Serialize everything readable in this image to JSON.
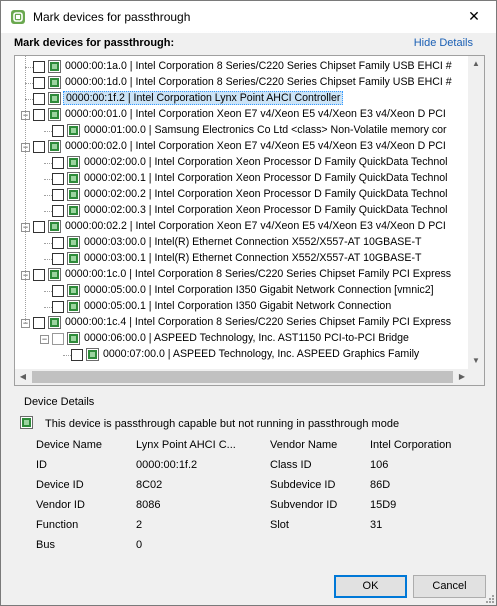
{
  "window": {
    "title": "Mark devices for passthrough",
    "close_glyph": "✕"
  },
  "section_title": "Mark devices for passthrough:",
  "hide_details": "Hide Details",
  "tree": [
    {
      "label": "0000:00:1a.0 | Intel Corporation 8 Series/C220 Series Chipset Family USB EHCI #",
      "level": 1,
      "expander": "",
      "checked": false,
      "selected": false,
      "icon": "pci-device-icon"
    },
    {
      "label": "0000:00:1d.0 | Intel Corporation 8 Series/C220 Series Chipset Family USB EHCI #",
      "level": 1,
      "expander": "",
      "checked": false,
      "selected": false,
      "icon": "pci-device-icon"
    },
    {
      "label": "0000:00:1f.2 | Intel Corporation Lynx Point AHCI Controller",
      "level": 1,
      "expander": "",
      "checked": false,
      "selected": true,
      "icon": "pci-device-icon"
    },
    {
      "label": "0000:00:01.0 | Intel Corporation Xeon E7 v4/Xeon E5 v4/Xeon E3 v4/Xeon D PCI",
      "level": 1,
      "expander": "−",
      "checked": false,
      "selected": false,
      "icon": "pci-device-icon"
    },
    {
      "label": "0000:01:00.0 | Samsung Electronics Co Ltd <class> Non-Volatile memory cor",
      "level": 2,
      "expander": "",
      "checked": false,
      "selected": false,
      "icon": "pci-device-icon"
    },
    {
      "label": "0000:00:02.0 | Intel Corporation Xeon E7 v4/Xeon E5 v4/Xeon E3 v4/Xeon D PCI",
      "level": 1,
      "expander": "−",
      "checked": false,
      "selected": false,
      "icon": "pci-device-icon"
    },
    {
      "label": "0000:02:00.0 | Intel Corporation Xeon Processor D Family QuickData Technol",
      "level": 2,
      "expander": "",
      "checked": false,
      "selected": false,
      "icon": "pci-device-icon"
    },
    {
      "label": "0000:02:00.1 | Intel Corporation Xeon Processor D Family QuickData Technol",
      "level": 2,
      "expander": "",
      "checked": false,
      "selected": false,
      "icon": "pci-device-icon"
    },
    {
      "label": "0000:02:00.2 | Intel Corporation Xeon Processor D Family QuickData Technol",
      "level": 2,
      "expander": "",
      "checked": false,
      "selected": false,
      "icon": "pci-device-icon"
    },
    {
      "label": "0000:02:00.3 | Intel Corporation Xeon Processor D Family QuickData Technol",
      "level": 2,
      "expander": "",
      "checked": false,
      "selected": false,
      "icon": "pci-device-icon"
    },
    {
      "label": "0000:00:02.2 | Intel Corporation Xeon E7 v4/Xeon E5 v4/Xeon E3 v4/Xeon D PCI",
      "level": 1,
      "expander": "−",
      "checked": false,
      "selected": false,
      "icon": "pci-device-icon"
    },
    {
      "label": "0000:03:00.0 | Intel(R) Ethernet Connection X552/X557-AT 10GBASE-T",
      "level": 2,
      "expander": "",
      "checked": false,
      "selected": false,
      "icon": "pci-device-icon"
    },
    {
      "label": "0000:03:00.1 | Intel(R) Ethernet Connection X552/X557-AT 10GBASE-T",
      "level": 2,
      "expander": "",
      "checked": false,
      "selected": false,
      "icon": "pci-device-icon"
    },
    {
      "label": "0000:00:1c.0 | Intel Corporation 8 Series/C220 Series Chipset Family PCI Express",
      "level": 1,
      "expander": "−",
      "checked": false,
      "selected": false,
      "icon": "pci-device-icon"
    },
    {
      "label": "0000:05:00.0 | Intel Corporation I350 Gigabit Network Connection [vmnic2]",
      "level": 2,
      "expander": "",
      "checked": false,
      "selected": false,
      "icon": "pci-device-icon"
    },
    {
      "label": "0000:05:00.1 | Intel Corporation I350 Gigabit Network Connection",
      "level": 2,
      "expander": "",
      "checked": false,
      "selected": false,
      "icon": "pci-device-icon"
    },
    {
      "label": "0000:00:1c.4 | Intel Corporation 8 Series/C220 Series Chipset Family PCI Express",
      "level": 1,
      "expander": "−",
      "checked": false,
      "selected": false,
      "icon": "pci-device-icon"
    },
    {
      "label": "0000:06:00.0 | ASPEED Technology, Inc. AST1150 PCI-to-PCI Bridge",
      "level": 2,
      "expander": "−",
      "checked": false,
      "selected": false,
      "icon": "pci-device-icon"
    },
    {
      "label": "0000:07:00.0 | ASPEED Technology, Inc. ASPEED Graphics Family",
      "level": 3,
      "expander": "",
      "checked": false,
      "selected": false,
      "icon": "pci-device-icon"
    }
  ],
  "device_details": {
    "title": "Device Details",
    "status": "This device is passthrough capable but not running in passthrough mode",
    "left": [
      {
        "label": "Device Name",
        "value": "Lynx Point AHCI C..."
      },
      {
        "label": "ID",
        "value": "0000:00:1f.2"
      },
      {
        "label": "Device ID",
        "value": "8C02"
      },
      {
        "label": "Vendor ID",
        "value": "8086"
      },
      {
        "label": "Function",
        "value": "2"
      },
      {
        "label": "Bus",
        "value": "0"
      }
    ],
    "right": [
      {
        "label": "Vendor Name",
        "value": "Intel Corporation"
      },
      {
        "label": "Class ID",
        "value": "106"
      },
      {
        "label": "Subdevice ID",
        "value": "86D"
      },
      {
        "label": "Subvendor ID",
        "value": "15D9"
      },
      {
        "label": "Slot",
        "value": "31"
      }
    ]
  },
  "buttons": {
    "ok": "OK",
    "cancel": "Cancel"
  },
  "colors": {
    "selection": "#cce4f7",
    "link": "#1a5fb4",
    "device_icon": "#2e8b3a"
  }
}
